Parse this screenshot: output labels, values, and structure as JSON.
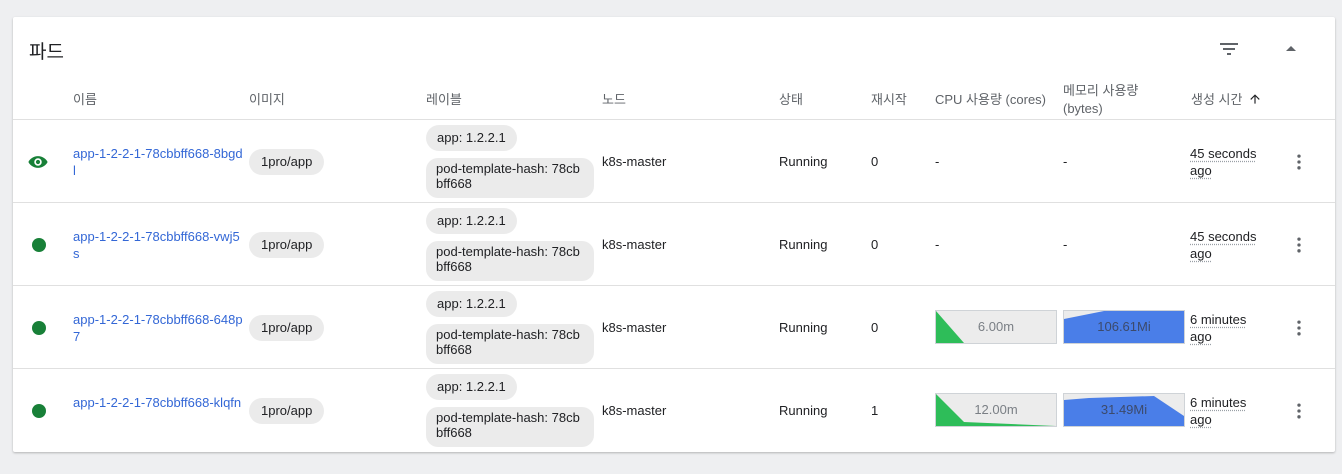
{
  "card": {
    "title": "파드"
  },
  "headers": {
    "name": "이름",
    "image": "이미지",
    "labels": "레이블",
    "node": "노드",
    "status": "상태",
    "restarts": "재시작",
    "cpu": "CPU 사용량 (cores)",
    "memory": "메모리 사용량 (bytes)",
    "created": "생성 시간",
    "sort_icon": "arrow-up-icon"
  },
  "colors": {
    "link": "#3367d6",
    "running": "#188038",
    "cpu_fill": "#2ebd59",
    "mem_fill": "#4a7ee8"
  },
  "rows": [
    {
      "status_icon": "eye-icon",
      "name": "app-1-2-2-1-78cbbff668-8bgdl",
      "image": "1pro/app",
      "label1": "app: 1.2.2.1",
      "label2": "pod-template-hash: 78cbbff668",
      "node": "k8s-master",
      "status": "Running",
      "restarts": "0",
      "cpu": "-",
      "memory": "-",
      "created": "45 seconds ago"
    },
    {
      "status_icon": "check-circle-icon",
      "name": "app-1-2-2-1-78cbbff668-vwj5s",
      "image": "1pro/app",
      "label1": "app: 1.2.2.1",
      "label2": "pod-template-hash: 78cbbff668",
      "node": "k8s-master",
      "status": "Running",
      "restarts": "0",
      "cpu": "-",
      "memory": "-",
      "created": "45 seconds ago"
    },
    {
      "status_icon": "check-circle-icon",
      "name": "app-1-2-2-1-78cbbff668-648p7",
      "image": "1pro/app",
      "label1": "app: 1.2.2.1",
      "label2": "pod-template-hash: 78cbbff668",
      "node": "k8s-master",
      "status": "Running",
      "restarts": "0",
      "cpu": "6.00m",
      "memory": "106.61Mi",
      "created": "6 minutes ago"
    },
    {
      "status_icon": "check-circle-icon",
      "name": "app-1-2-2-1-78cbbff668-klqfn",
      "image": "1pro/app",
      "label1": "app: 1.2.2.1",
      "label2": "pod-template-hash: 78cbbff668",
      "node": "k8s-master",
      "status": "Running",
      "restarts": "1",
      "cpu": "12.00m",
      "memory": "31.49Mi",
      "created": "6 minutes ago"
    }
  ]
}
